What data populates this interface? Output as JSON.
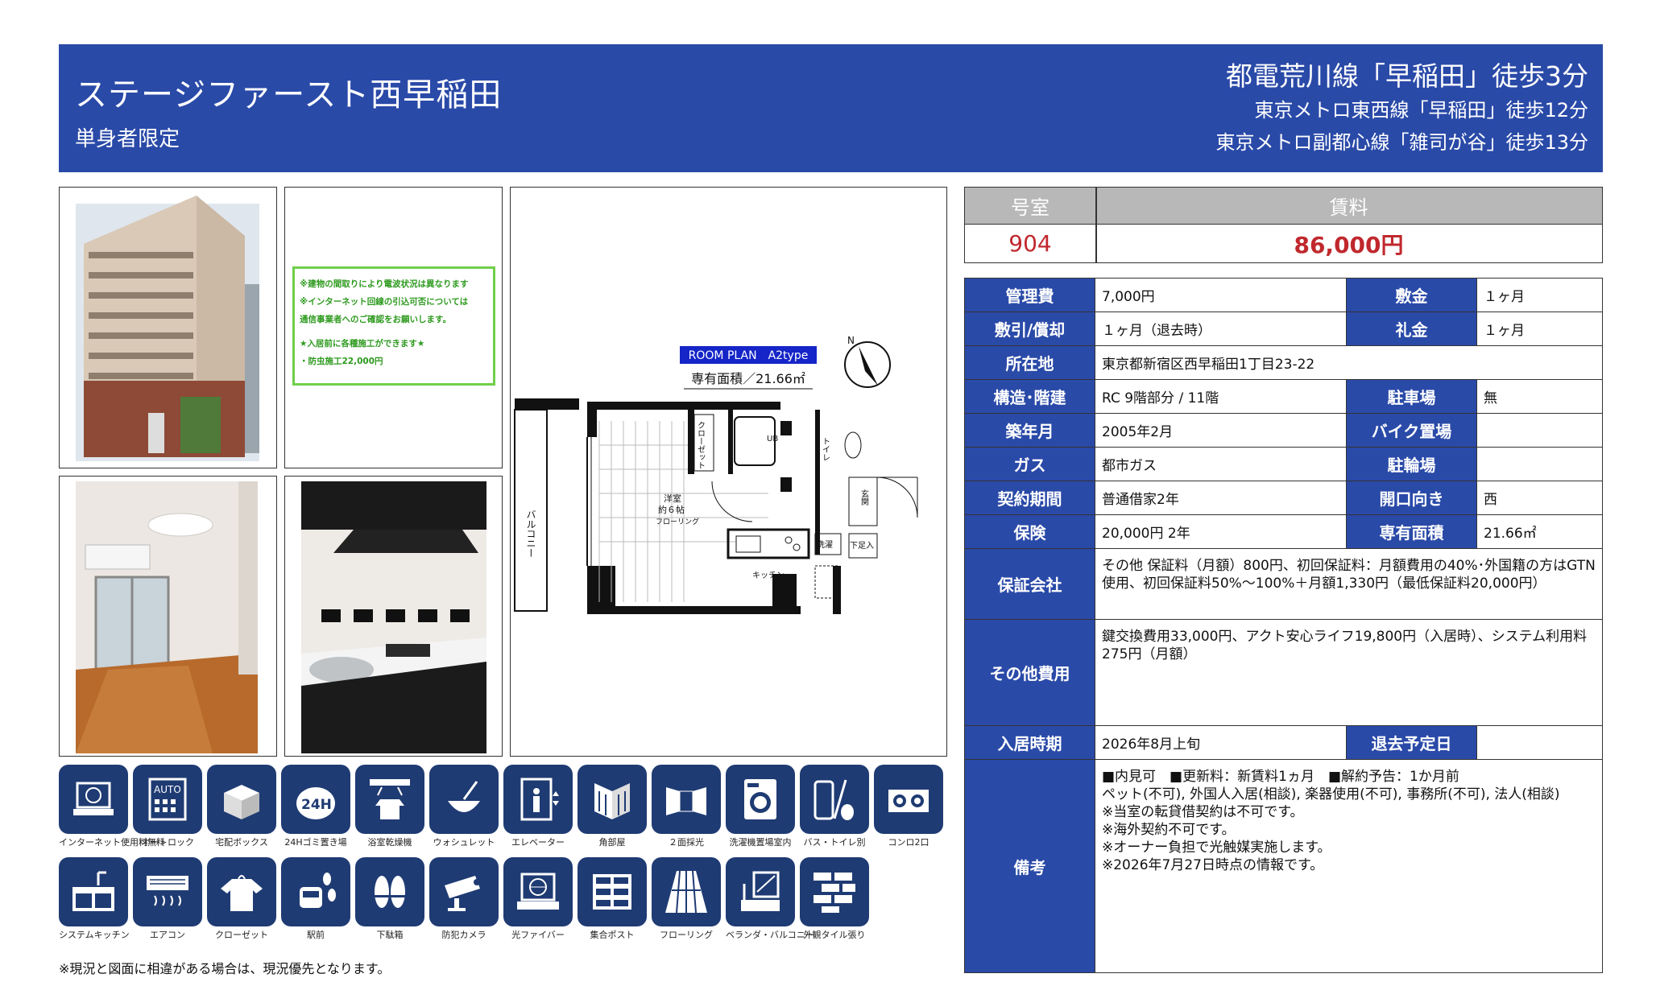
{
  "header": {
    "title": "ステージファースト西早稲田",
    "subtitle": "単身者限定",
    "access": [
      "都電荒川線「早稲田」徒歩3分",
      "東京メトロ東西線「早稲田」徒歩12分",
      "東京メトロ副都心線「雑司が谷」徒歩13分"
    ]
  },
  "note": {
    "lines": [
      "※建物の間取りにより電波状況は異なります",
      "※インターネット回線の引込可否については",
      "通信事業者へのご確認をお願いします。",
      "",
      "★入居前に各種施工ができます★",
      "・防虫施工22,000円"
    ],
    "border_color": "#6fcf4a"
  },
  "floorplan": {
    "badge": "ROOM PLAN　A2type",
    "area": "専有面積／21.66㎡",
    "labels": {
      "balcony": "バルコニー",
      "room": "洋室",
      "room_size": "約６帖",
      "flooring": "フローリング",
      "closet": "クローゼット",
      "ub": "UB",
      "toilet": "トイレ",
      "entrance": "玄関",
      "washer": "洗濯",
      "shoebox": "下足入",
      "kitchen": "キッチン",
      "compass": "N"
    }
  },
  "amenities": [
    {
      "label": "インターネット使用料無料",
      "icon": "internet-icon"
    },
    {
      "label": "オートロック",
      "icon": "autolock-icon"
    },
    {
      "label": "宅配ボックス",
      "icon": "delivery-box-icon"
    },
    {
      "label": "24Hゴミ置き場",
      "icon": "garbage-24h-icon"
    },
    {
      "label": "浴室乾燥機",
      "icon": "bath-dryer-icon"
    },
    {
      "label": "ウォシュレット",
      "icon": "washlet-icon"
    },
    {
      "label": "エレベーター",
      "icon": "elevator-icon"
    },
    {
      "label": "角部屋",
      "icon": "corner-room-icon"
    },
    {
      "label": "２面採光",
      "icon": "two-side-light-icon"
    },
    {
      "label": "洗濯機置場室内",
      "icon": "washing-machine-icon"
    },
    {
      "label": "バス・トイレ別",
      "icon": "bath-toilet-separate-icon"
    },
    {
      "label": "コンロ2口",
      "icon": "stove-2-icon"
    },
    {
      "label": "システムキッチン",
      "icon": "system-kitchen-icon"
    },
    {
      "label": "エアコン",
      "icon": "air-conditioner-icon"
    },
    {
      "label": "クローゼット",
      "icon": "closet-icon"
    },
    {
      "label": "駅前",
      "icon": "station-icon"
    },
    {
      "label": "下駄箱",
      "icon": "shoe-rack-icon"
    },
    {
      "label": "防犯カメラ",
      "icon": "security-camera-icon"
    },
    {
      "label": "光ファイバー",
      "icon": "fiber-optic-icon"
    },
    {
      "label": "集合ポスト",
      "icon": "mailbox-icon"
    },
    {
      "label": "フローリング",
      "icon": "flooring-icon"
    },
    {
      "label": "ベランダ・バルコニー",
      "icon": "balcony-icon"
    },
    {
      "label": "外観タイル張り",
      "icon": "tile-exterior-icon"
    }
  ],
  "footnote": "※現況と図面に相違がある場合は、現況優先となります。",
  "rent": {
    "room_label": "号室",
    "room": "904",
    "rent_label": "賃料",
    "rent": "86,000円",
    "value_color": "#c0282d"
  },
  "info": {
    "kanrihi_label": "管理費",
    "kanrihi": "7,000円",
    "shikikin_label": "敷金",
    "shikikin": "１ヶ月",
    "shikibiki_label": "敷引/償却",
    "shikibiki": "１ヶ月（退去時）",
    "reikin_label": "礼金",
    "reikin": "１ヶ月",
    "address_label": "所在地",
    "address": "東京都新宿区西早稲田1丁目23-22",
    "structure_label": "構造･階建",
    "structure": "RC 9階部分 / 11階",
    "parking_label": "駐車場",
    "parking": "無",
    "built_label": "築年月",
    "built": "2005年2月",
    "bike_label": "バイク置場",
    "bike": "",
    "gas_label": "ガス",
    "gas": "都市ガス",
    "bicycle_label": "駐輪場",
    "bicycle": "",
    "contract_label": "契約期間",
    "contract": "普通借家2年",
    "direction_label": "開口向き",
    "direction": "西",
    "insurance_label": "保険",
    "insurance": "20,000円 2年",
    "area_label": "専有面積",
    "area": "21.66㎡",
    "guarantee_label": "保証会社",
    "guarantee": "その他 保証料（月額）800円、初回保証料：月額費用の40%･外国籍の方はGTN使用、初回保証料50%～100%＋月額1,330円（最低保証料20,000円）",
    "other_label": "その他費用",
    "other": "鍵交換費用33,000円、アクト安心ライフ19,800円（入居時）、システム利用料275円（月額）",
    "movein_label": "入居時期",
    "movein": "2026年8月上旬",
    "moveout_label": "退去予定日",
    "moveout": "",
    "remarks_label": "備考",
    "remarks": [
      "■内見可　■更新料：新賃料1ヵ月　■解約予告：1か月前",
      "ペット(不可), 外国人入居(相談), 楽器使用(不可), 事務所(不可), 法人(相談)",
      "※当室の転貸借契約は不可です。",
      "※海外契約不可です。",
      "※オーナー負担で光触媒実施します。",
      "※2026年7月27日時点の情報です。"
    ]
  },
  "colors": {
    "header_bg": "#2a4aa8",
    "label_bg": "#2a4aa8",
    "icon_bg": "#1f3b73",
    "rent_header_bg": "#b8b8b8"
  }
}
